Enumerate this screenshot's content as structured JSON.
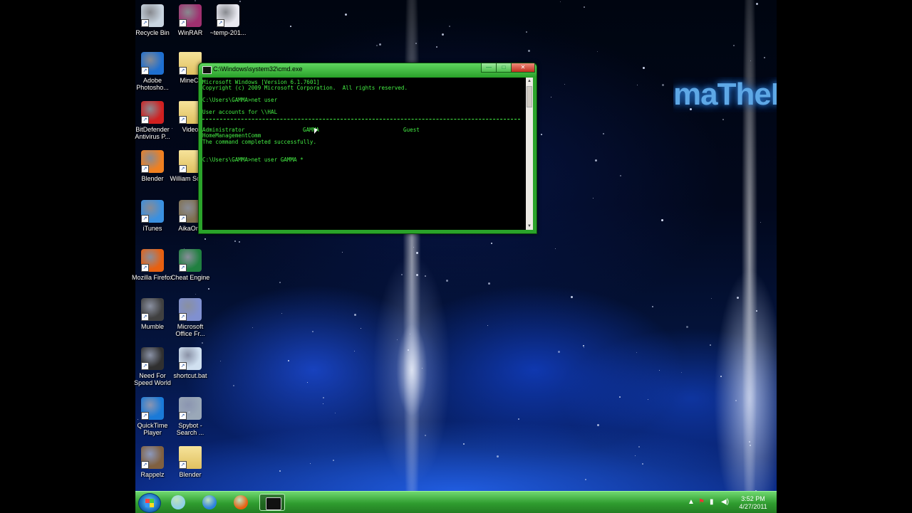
{
  "wallpaper_text": "maThePyro",
  "desktop_icons": [
    {
      "label": "Recycle Bin",
      "icon": "recycle-bin-icon",
      "color": "#c8d4e0"
    },
    {
      "label": "WinRAR",
      "icon": "winrar-icon",
      "color": "#a03070"
    },
    {
      "label": "~temp-201...",
      "icon": "avi-file-icon",
      "color": "#e8e8f0"
    },
    {
      "label": "Adobe Photosho...",
      "icon": "camera-icon",
      "color": "#1e6fd0"
    },
    {
      "label": "MineCr",
      "icon": "folder-icon",
      "color": "#e0c060"
    },
    {
      "label": "BitDefender Antivirus P...",
      "icon": "bitdefender-icon",
      "color": "#d02020"
    },
    {
      "label": "Video",
      "icon": "folder-icon",
      "color": "#e0c060"
    },
    {
      "label": "Blender",
      "icon": "blender-icon",
      "color": "#f08020"
    },
    {
      "label": "William Schoo",
      "icon": "folder-icon",
      "color": "#e0c060"
    },
    {
      "label": "iTunes",
      "icon": "itunes-icon",
      "color": "#3a90e0"
    },
    {
      "label": "AikaOnli",
      "icon": "aika-icon",
      "color": "#807050"
    },
    {
      "label": "Mozilla Firefox",
      "icon": "firefox-icon",
      "color": "#e86010"
    },
    {
      "label": "Cheat Engine",
      "icon": "cheat-engine-icon",
      "color": "#208040"
    },
    {
      "label": "Mumble",
      "icon": "mumble-icon",
      "color": "#404040"
    },
    {
      "label": "Microsoft Office Fr...",
      "icon": "office-icon",
      "color": "#8090d0"
    },
    {
      "label": "Need For Speed World",
      "icon": "nfs-icon",
      "color": "#303030"
    },
    {
      "label": "shortcut.bat",
      "icon": "bat-file-icon",
      "color": "#d0e0f0"
    },
    {
      "label": "QuickTime Player",
      "icon": "quicktime-icon",
      "color": "#1a7ad8"
    },
    {
      "label": "Spybot - Search ...",
      "icon": "spybot-icon",
      "color": "#9aa8b8"
    },
    {
      "label": "Rappelz",
      "icon": "rappelz-icon",
      "color": "#806040"
    },
    {
      "label": "Blender",
      "icon": "folder-icon",
      "color": "#e0c060"
    }
  ],
  "cmd_window": {
    "title": "C:\\Windows\\system32\\cmd.exe",
    "min_label": "—",
    "max_label": "□",
    "close_label": "✕",
    "lines": {
      "l1": "Microsoft Windows [Version 6.1.7601]",
      "l2": "Copyright (c) 2009 Microsoft Corporation.  All rights reserved.",
      "l3": "C:\\Users\\GAMMA>net user",
      "l4": "User accounts for \\\\HAL",
      "l5_a": "Administrator",
      "l5_b": "GAMMA",
      "l5_c": "Guest",
      "l6": "HomeManagementComm",
      "l7": "The command completed successfully.",
      "l8": "C:\\Users\\GAMMA>net user GAMMA *"
    }
  },
  "taskbar": {
    "pinned": [
      {
        "name": "windows-explorer",
        "color": "#8fd0e8"
      },
      {
        "name": "itunes",
        "color": "#2a80e0"
      },
      {
        "name": "firefox",
        "color": "#e86010"
      },
      {
        "name": "cmd",
        "color": "#111111"
      }
    ],
    "clock_time": "3:52 PM",
    "clock_date": "4/27/2011"
  },
  "colors": {
    "console_text": "#44ee44",
    "window_frame": "#2aa32a",
    "taskbar": "#2f9c2f"
  }
}
